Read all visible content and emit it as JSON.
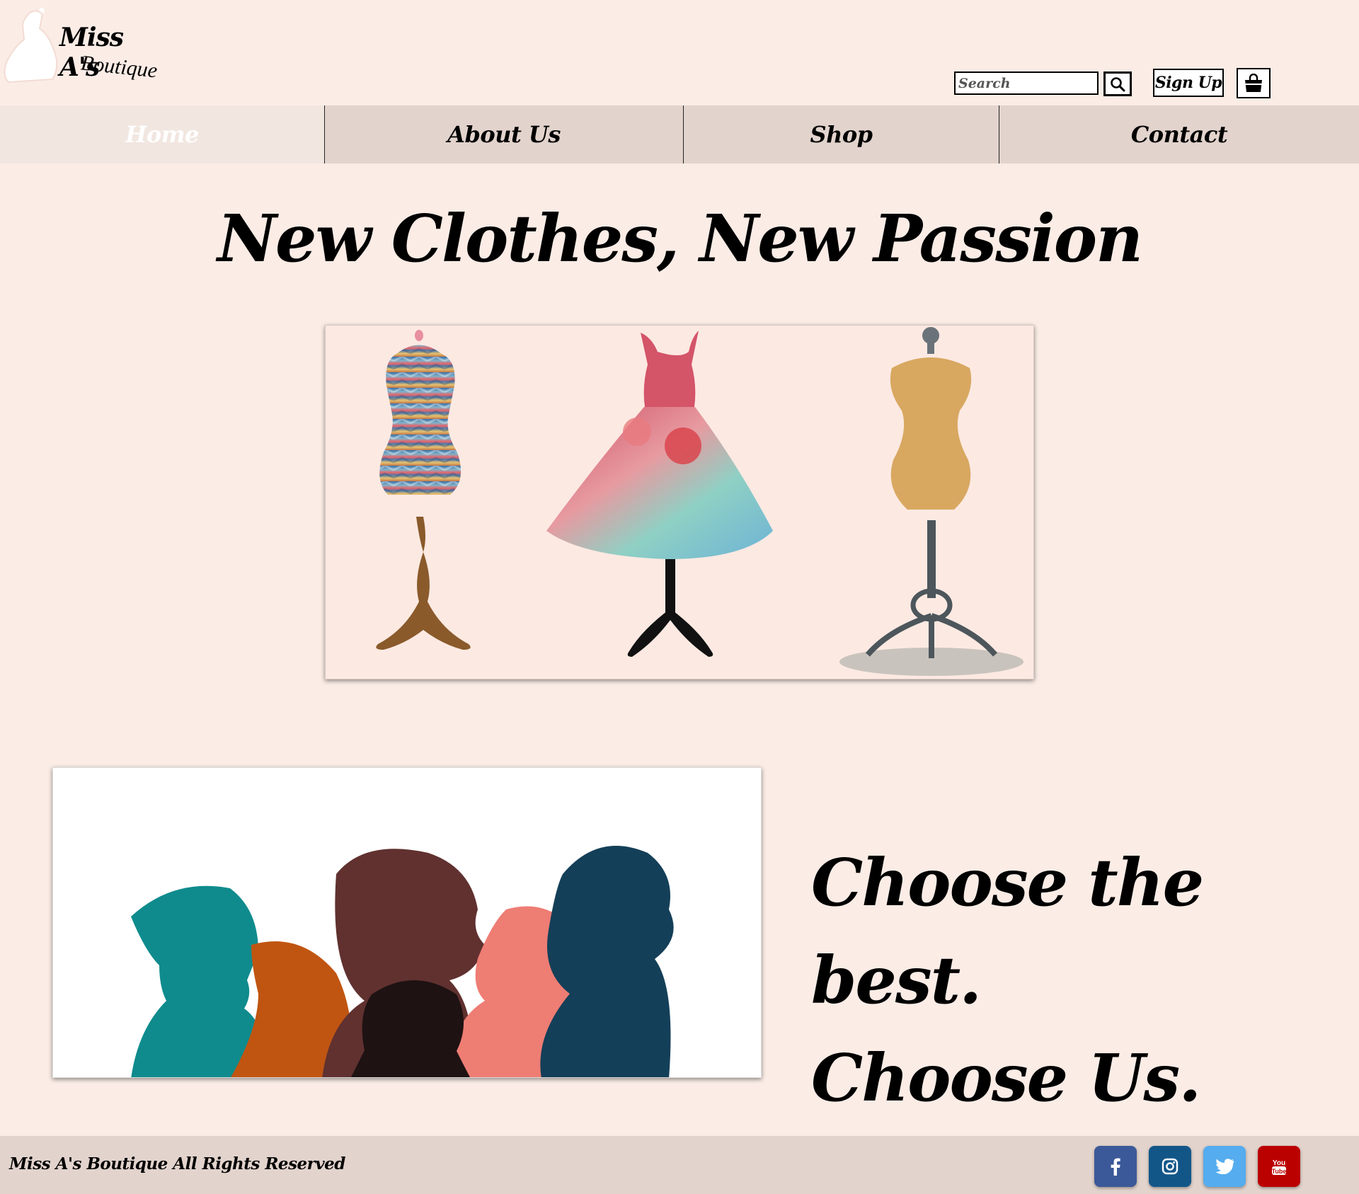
{
  "header": {
    "logo_title": "Miss A's",
    "logo_subtitle": "Boutique",
    "search_placeholder": "Search",
    "signup_label": "Sign Up"
  },
  "nav": {
    "items": [
      {
        "label": "Home",
        "active": true
      },
      {
        "label": "About Us",
        "active": false
      },
      {
        "label": "Shop",
        "active": false
      },
      {
        "label": "Contact",
        "active": false
      }
    ]
  },
  "main": {
    "hero_title": "New Clothes, New Passion",
    "tagline_line1": "Choose the best.",
    "tagline_line2": "Choose Us."
  },
  "footer": {
    "copyright": "Miss A's Boutique All Rights Reserved",
    "social": [
      {
        "icon": "facebook-icon",
        "color": "#3b5998"
      },
      {
        "icon": "instagram-icon",
        "color": "#125688"
      },
      {
        "icon": "twitter-icon",
        "color": "#55acee"
      },
      {
        "icon": "youtube-icon",
        "color": "#bb0000"
      }
    ]
  },
  "colors": {
    "page_background": "#fbece6",
    "nav_background": "#e2d3cd",
    "nav_active_background": "#f1e6e0"
  }
}
